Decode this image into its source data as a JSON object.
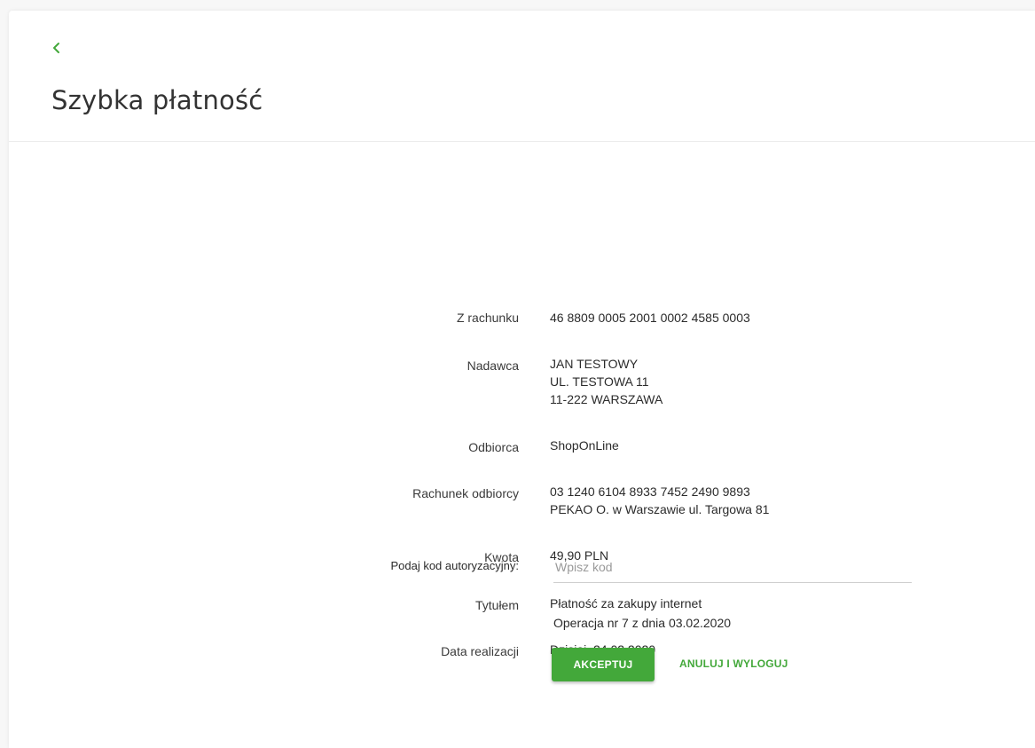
{
  "page": {
    "title": "Szybka płatność",
    "back_icon": "chevron-left-icon",
    "accent_color": "#43a83a"
  },
  "fields": {
    "from_account": {
      "label": "Z rachunku",
      "value": "46 8809 0005 2001 0002 4585 0003"
    },
    "sender": {
      "label": "Nadawca",
      "lines": [
        "JAN TESTOWY",
        "UL. TESTOWA 11",
        "11-222 WARSZAWA"
      ]
    },
    "recipient": {
      "label": "Odbiorca",
      "value": "ShopOnLine"
    },
    "recipient_account": {
      "label": "Rachunek odbiorcy",
      "lines": [
        "03 1240 6104 8933 7452 2490 9893",
        "PEKAO O. w Warszawie  ul. Targowa 81"
      ]
    },
    "amount": {
      "label": "Kwota",
      "value": "49,90 PLN"
    },
    "title": {
      "label": "Tytułem",
      "value": "Płatność za zakupy internet"
    },
    "execution_date": {
      "label": "Data realizacji",
      "value": "Dzisiaj, 24.02.2020"
    }
  },
  "authorization": {
    "label": "Podaj kod autoryzacyjny:",
    "placeholder": "Wpisz kod",
    "value": "",
    "operation_info": "Operacja nr 7 z dnia 03.02.2020"
  },
  "actions": {
    "accept_label": "AKCEPTUJ",
    "cancel_label": "ANULUJ I WYLOGUJ"
  }
}
